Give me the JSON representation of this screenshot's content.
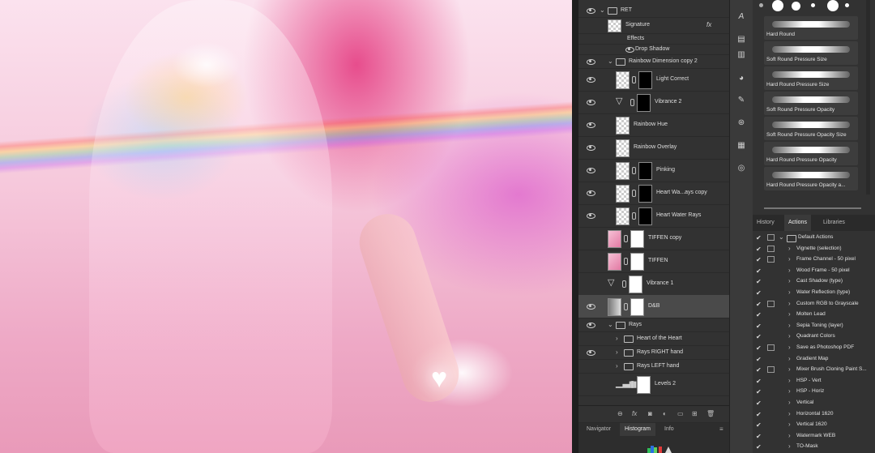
{
  "layers": [
    {
      "name": "RET",
      "kind": "group",
      "indent": 0,
      "visible": true
    },
    {
      "name": "Signature",
      "kind": "text",
      "indent": 1,
      "visible": false,
      "fx": "fx"
    },
    {
      "name": "Effects",
      "kind": "effects",
      "indent": 2,
      "visible": false
    },
    {
      "name": "Drop Shadow",
      "kind": "effect",
      "indent": 3,
      "visible": false
    },
    {
      "name": "Rainbow Dimension copy 2",
      "kind": "group",
      "indent": 1,
      "visible": true
    },
    {
      "name": "Light Correct",
      "kind": "mask",
      "indent": 2,
      "visible": true
    },
    {
      "name": "Vibrance 2",
      "kind": "adj",
      "indent": 2,
      "visible": true
    },
    {
      "name": "Rainbow Hue",
      "kind": "layer",
      "indent": 2,
      "visible": true
    },
    {
      "name": "Rainbow Overlay",
      "kind": "layer",
      "indent": 2,
      "visible": true
    },
    {
      "name": "Pinking",
      "kind": "mask",
      "indent": 2,
      "visible": true
    },
    {
      "name": "Heart Wa...ays copy",
      "kind": "mask",
      "indent": 2,
      "visible": true
    },
    {
      "name": "Heart Water Rays",
      "kind": "mask",
      "indent": 2,
      "visible": true
    },
    {
      "name": "TIFFEN copy",
      "kind": "pinkmask",
      "indent": 1,
      "visible": false
    },
    {
      "name": "TIFFEN",
      "kind": "pinkmask",
      "indent": 1,
      "visible": false
    },
    {
      "name": "Vibrance 1",
      "kind": "adj",
      "indent": 1,
      "visible": false
    },
    {
      "name": "D&B",
      "kind": "mask",
      "indent": 1,
      "visible": true,
      "selected": true
    },
    {
      "name": "Rays",
      "kind": "group",
      "indent": 1,
      "visible": true
    },
    {
      "name": "Heart of the Heart",
      "kind": "group",
      "indent": 2,
      "visible": false
    },
    {
      "name": "Rays RIGHT hand",
      "kind": "group",
      "indent": 2,
      "visible": true
    },
    {
      "name": "Rays LEFT hand",
      "kind": "group",
      "indent": 2,
      "visible": false
    },
    {
      "name": "Levels 2",
      "kind": "levels",
      "indent": 2,
      "visible": false
    }
  ],
  "panel_tabs": {
    "navigator": "Navigator",
    "histogram": "Histogram",
    "info": "Info"
  },
  "brushes": [
    {
      "name": "Hard Round"
    },
    {
      "name": "Soft Round Pressure Size"
    },
    {
      "name": "Hard Round Pressure Size"
    },
    {
      "name": "Soft Round Pressure Opacity"
    },
    {
      "name": "Soft Round Pressure Opacity Size"
    },
    {
      "name": "Hard Round Pressure Opacity"
    },
    {
      "name": "Hard Round Pressure Opacity a..."
    }
  ],
  "action_tabs": {
    "history": "History",
    "actions": "Actions",
    "libraries": "Libraries"
  },
  "actions": [
    {
      "name": "Default Actions",
      "folder": true,
      "dialog": true
    },
    {
      "name": "Vignette (selection)",
      "dialog": true
    },
    {
      "name": "Frame Channel - 50 pixel",
      "dialog": true
    },
    {
      "name": "Wood Frame - 50 pixel",
      "dialog": false
    },
    {
      "name": "Cast Shadow (type)",
      "dialog": false
    },
    {
      "name": "Water Reflection (type)",
      "dialog": false
    },
    {
      "name": "Custom RGB to Grayscale",
      "dialog": true
    },
    {
      "name": "Molten Lead",
      "dialog": false
    },
    {
      "name": "Sepia Toning (layer)",
      "dialog": false
    },
    {
      "name": "Quadrant Colors",
      "dialog": false
    },
    {
      "name": "Save as Photoshop PDF",
      "dialog": true
    },
    {
      "name": "Gradient Map",
      "dialog": false
    },
    {
      "name": "Mixer Brush Cloning Paint S...",
      "dialog": true
    },
    {
      "name": "HSP - Vert",
      "dialog": false
    },
    {
      "name": "HSP - Horiz",
      "dialog": false
    },
    {
      "name": "Vertical",
      "dialog": false
    },
    {
      "name": "Horizontal 1620",
      "dialog": false
    },
    {
      "name": "Vertical 1620",
      "dialog": false
    },
    {
      "name": "Watermark WEB",
      "dialog": false
    },
    {
      "name": "TO-Mask",
      "dialog": false
    }
  ],
  "colors": {
    "panel": "#323232",
    "selected": "#4a4a4a",
    "accent_canvas_pink": "#e99ab9"
  }
}
